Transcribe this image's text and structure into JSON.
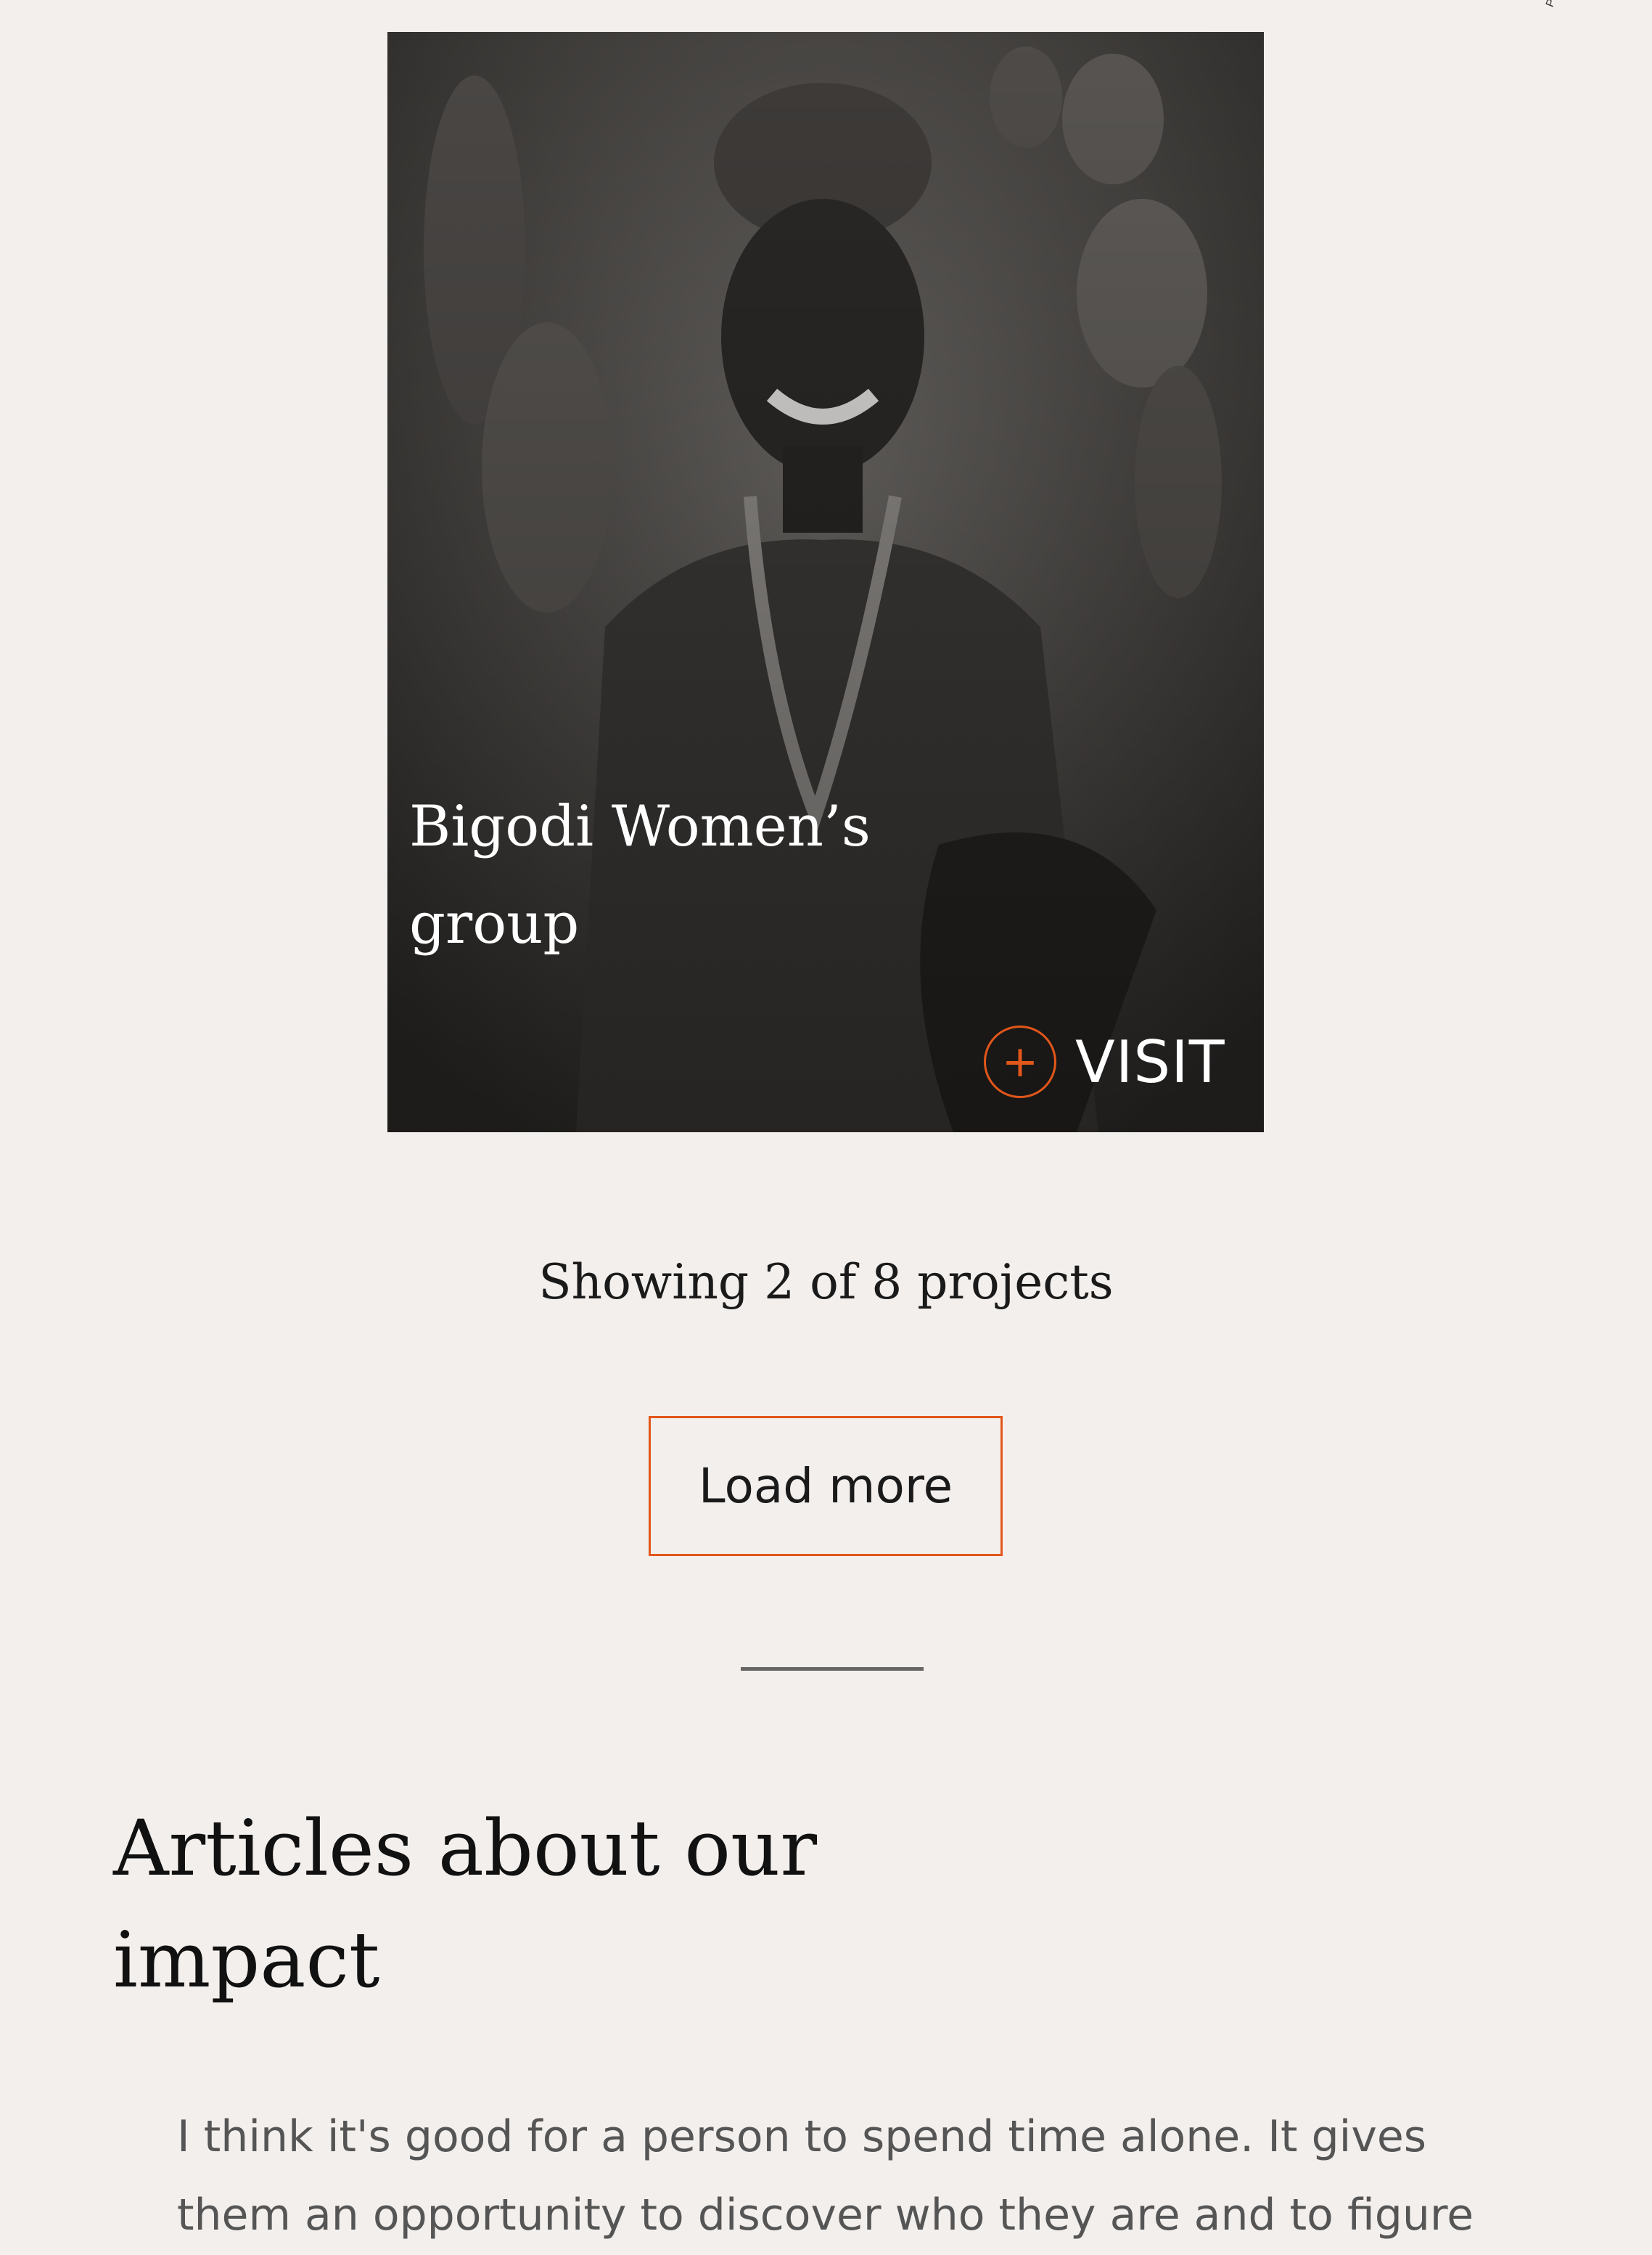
{
  "photo_credit": "Photo",
  "project_card": {
    "title": "Bigodi Women’s group",
    "visit_label": "VISIT",
    "visit_icon": "plus-circle-icon"
  },
  "pagination": {
    "status_text": "Showing 2 of 8 projects",
    "load_more_label": "Load more"
  },
  "articles_section": {
    "heading": "Articles about our impact",
    "excerpt": "I think it's good for a person to spend time alone. It gives them an opportunity to discover who they are and to figure"
  },
  "colors": {
    "background": "#f3efec",
    "accent": "#e2571a",
    "text_dark": "#1a1a1a",
    "text_muted": "#555555"
  }
}
